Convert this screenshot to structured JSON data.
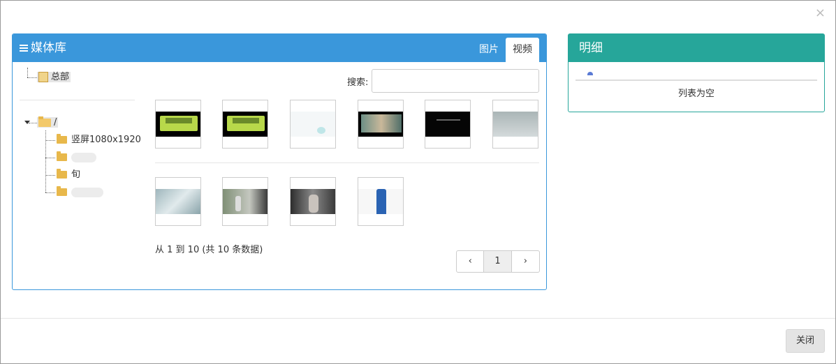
{
  "media": {
    "title": "媒体库",
    "tabs": [
      {
        "label": "图片"
      },
      {
        "label": "视频"
      }
    ],
    "active_tab": "视频"
  },
  "tree": {
    "root_label": "总部",
    "dir_root": "/",
    "children": [
      {
        "label": "竖屏1080x1920"
      },
      {
        "label": ""
      },
      {
        "label": "旬"
      },
      {
        "label": ""
      }
    ]
  },
  "search": {
    "label": "搜索:",
    "placeholder": ""
  },
  "thumbnails": [
    {
      "kind": "green-ui"
    },
    {
      "kind": "green-ui"
    },
    {
      "kind": "white"
    },
    {
      "kind": "street"
    },
    {
      "kind": "dark-text"
    },
    {
      "kind": "grey-sky"
    },
    {
      "kind": "water"
    },
    {
      "kind": "person-window"
    },
    {
      "kind": "person-hall"
    },
    {
      "kind": "product-bottle"
    }
  ],
  "pagination": {
    "info": "从 1 到 10 (共 10 条数据)",
    "prev": "‹",
    "current": "1",
    "next": "›"
  },
  "detail": {
    "title": "明细",
    "empty_text": "列表为空"
  },
  "footer": {
    "close_label": "关闭"
  },
  "close_icon": "×",
  "colors": {
    "media_header": "#3a97db",
    "detail_header": "#26a69a"
  }
}
